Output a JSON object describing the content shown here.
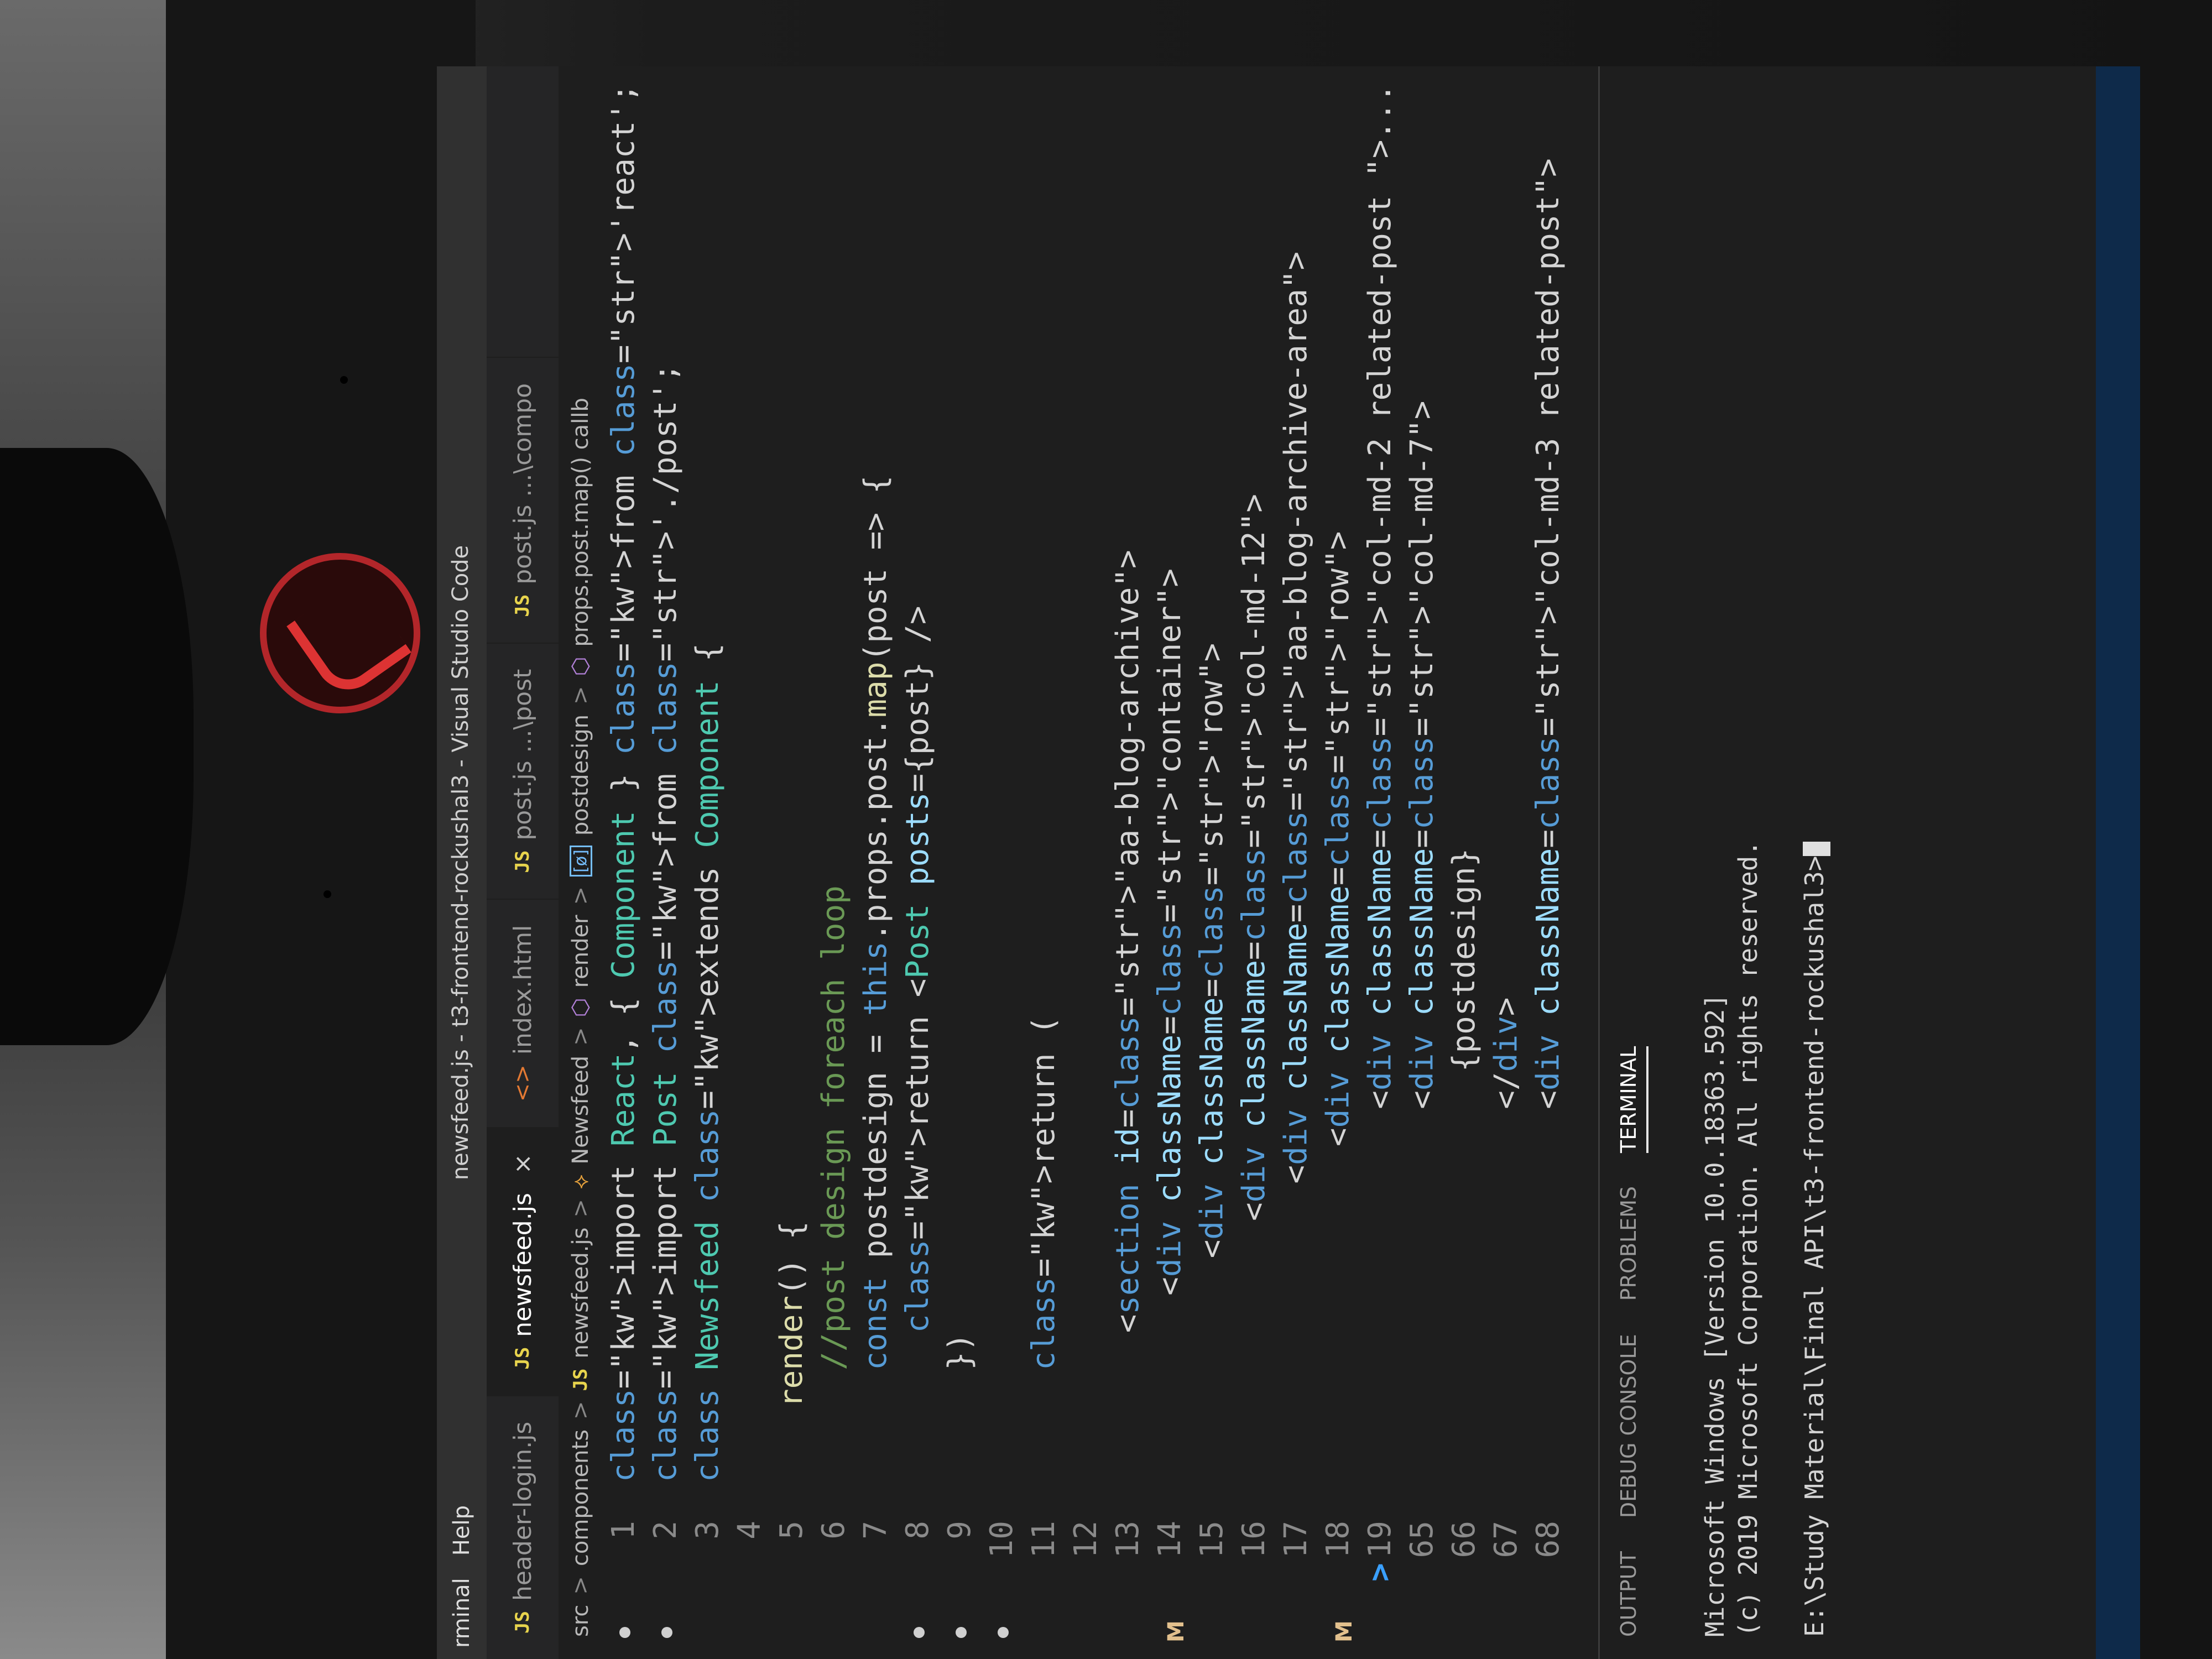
{
  "window": {
    "title": "newsfeed.js - t3-frontend-rockushal3 - Visual Studio Code",
    "menu": [
      "rminal",
      "Help"
    ]
  },
  "tabs": [
    {
      "badge": "JS",
      "label": "header-login.js",
      "active": false
    },
    {
      "badge": "JS",
      "label": "newsfeed.js",
      "active": true,
      "close": "×"
    },
    {
      "badge": "<>",
      "label": "index.html",
      "active": false
    },
    {
      "badge": "JS",
      "label": "post.js ...\\post",
      "active": false
    },
    {
      "badge": "JS",
      "label": "post.js ...\\compo",
      "active": false
    }
  ],
  "breadcrumb": {
    "items": [
      "src",
      "components",
      "newsfeed.js",
      "Newsfeed",
      "render",
      "postdesign",
      "props.post.map() callb"
    ],
    "sep": ">",
    "js_badge": "JS",
    "class_icon": "⟡",
    "method_icon": "⬡",
    "var_icon": "[ø]"
  },
  "code": [
    {
      "n": "1",
      "text": "import React, { Component } from 'react';"
    },
    {
      "n": "2",
      "text": "import Post from './post';"
    },
    {
      "n": "3",
      "text": "class Newsfeed extends Component {"
    },
    {
      "n": "4",
      "text": ""
    },
    {
      "n": "5",
      "text": "    render() {"
    },
    {
      "n": "6",
      "text": "      //post design foreach loop"
    },
    {
      "n": "7",
      "text": "      const postdesign = this.props.post.map(post => {"
    },
    {
      "n": "8",
      "text": "        return <Post posts={post} />"
    },
    {
      "n": "9",
      "text": "      })"
    },
    {
      "n": "10",
      "text": ""
    },
    {
      "n": "11",
      "text": "      return ("
    },
    {
      "n": "12",
      "text": ""
    },
    {
      "n": "13",
      "text": "        <section id=\"aa-blog-archive\">"
    },
    {
      "n": "14",
      "text": "          <div className=\"container\">"
    },
    {
      "n": "15",
      "text": "            <div className=\"row\">"
    },
    {
      "n": "16",
      "text": "              <div className=\"col-md-12\">"
    },
    {
      "n": "17",
      "text": "                <div className=\"aa-blog-archive-area\">"
    },
    {
      "n": "18",
      "text": "                  <div className=\"row\">"
    },
    {
      "n": "19",
      "text": "                    <div className=\"col-md-2 related-post \">..."
    },
    {
      "n": "65",
      "text": "                    <div className=\"col-md-7\">"
    },
    {
      "n": "66",
      "text": "                      {postdesign}"
    },
    {
      "n": "67",
      "text": "                    </div>"
    },
    {
      "n": "68",
      "text": "                    <div className=\"col-md-3 related-post\">"
    }
  ],
  "fold_glyph": ">",
  "git_modified": "M",
  "panel": {
    "tabs": [
      "OUTPUT",
      "DEBUG CONSOLE",
      "PROBLEMS",
      "TERMINAL"
    ],
    "active": "TERMINAL",
    "terminal_lines": [
      "Microsoft Windows [Version 10.0.18363.592]",
      "(c) 2019 Microsoft Corporation. All rights reserved.",
      "",
      "E:\\Study Material\\Final API\\t3-frontend-rockushal3>"
    ]
  },
  "icons": {
    "js": "js-file-icon",
    "html": "html-file-icon",
    "close": "close-icon",
    "fold": "chevron-right-icon",
    "logo": "rog-logo-icon"
  }
}
